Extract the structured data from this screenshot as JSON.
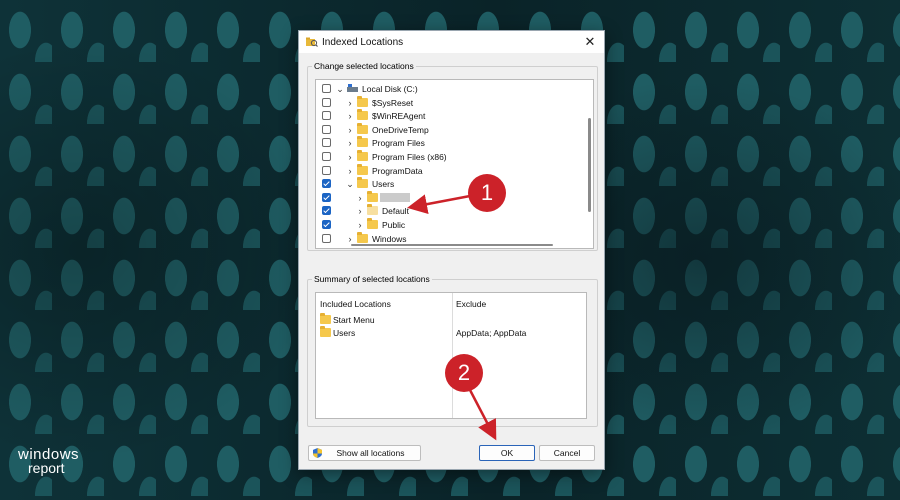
{
  "window": {
    "title": "Indexed Locations"
  },
  "change_group": {
    "legend": "Change selected locations",
    "tree": [
      {
        "label": "Local Disk (C:)",
        "checked": false,
        "level": 0,
        "expanded": true,
        "kind": "drive"
      },
      {
        "label": "$SysReset",
        "checked": false,
        "level": 1,
        "expanded": false,
        "kind": "folder"
      },
      {
        "label": "$WinREAgent",
        "checked": false,
        "level": 1,
        "expanded": false,
        "kind": "folder"
      },
      {
        "label": "OneDriveTemp",
        "checked": false,
        "level": 1,
        "expanded": false,
        "kind": "folder"
      },
      {
        "label": "Program Files",
        "checked": false,
        "level": 1,
        "expanded": false,
        "kind": "folder"
      },
      {
        "label": "Program Files (x86)",
        "checked": false,
        "level": 1,
        "expanded": false,
        "kind": "folder"
      },
      {
        "label": "ProgramData",
        "checked": false,
        "level": 1,
        "expanded": false,
        "kind": "folder"
      },
      {
        "label": "Users",
        "checked": true,
        "level": 1,
        "expanded": true,
        "kind": "folder"
      },
      {
        "label": "",
        "checked": true,
        "level": 2,
        "expanded": false,
        "kind": "blurred"
      },
      {
        "label": "Default",
        "checked": true,
        "level": 2,
        "expanded": false,
        "kind": "folder-light"
      },
      {
        "label": "Public",
        "checked": true,
        "level": 2,
        "expanded": false,
        "kind": "folder"
      },
      {
        "label": "Windows",
        "checked": false,
        "level": 1,
        "expanded": false,
        "kind": "folder"
      }
    ]
  },
  "summary_group": {
    "legend": "Summary of selected locations",
    "col_included": "Included Locations",
    "col_exclude": "Exclude",
    "included": [
      "Start Menu",
      "Users"
    ],
    "exclude": [
      "",
      "AppData; AppData"
    ]
  },
  "buttons": {
    "show_all": "Show all locations",
    "ok": "OK",
    "cancel": "Cancel"
  },
  "annotations": {
    "step1": "1",
    "step2": "2"
  },
  "brand": {
    "line1": "windows",
    "line2": "report"
  },
  "colors": {
    "accent": "#1b64c4",
    "annotation": "#cc2229",
    "folder": "#f5c84c"
  }
}
